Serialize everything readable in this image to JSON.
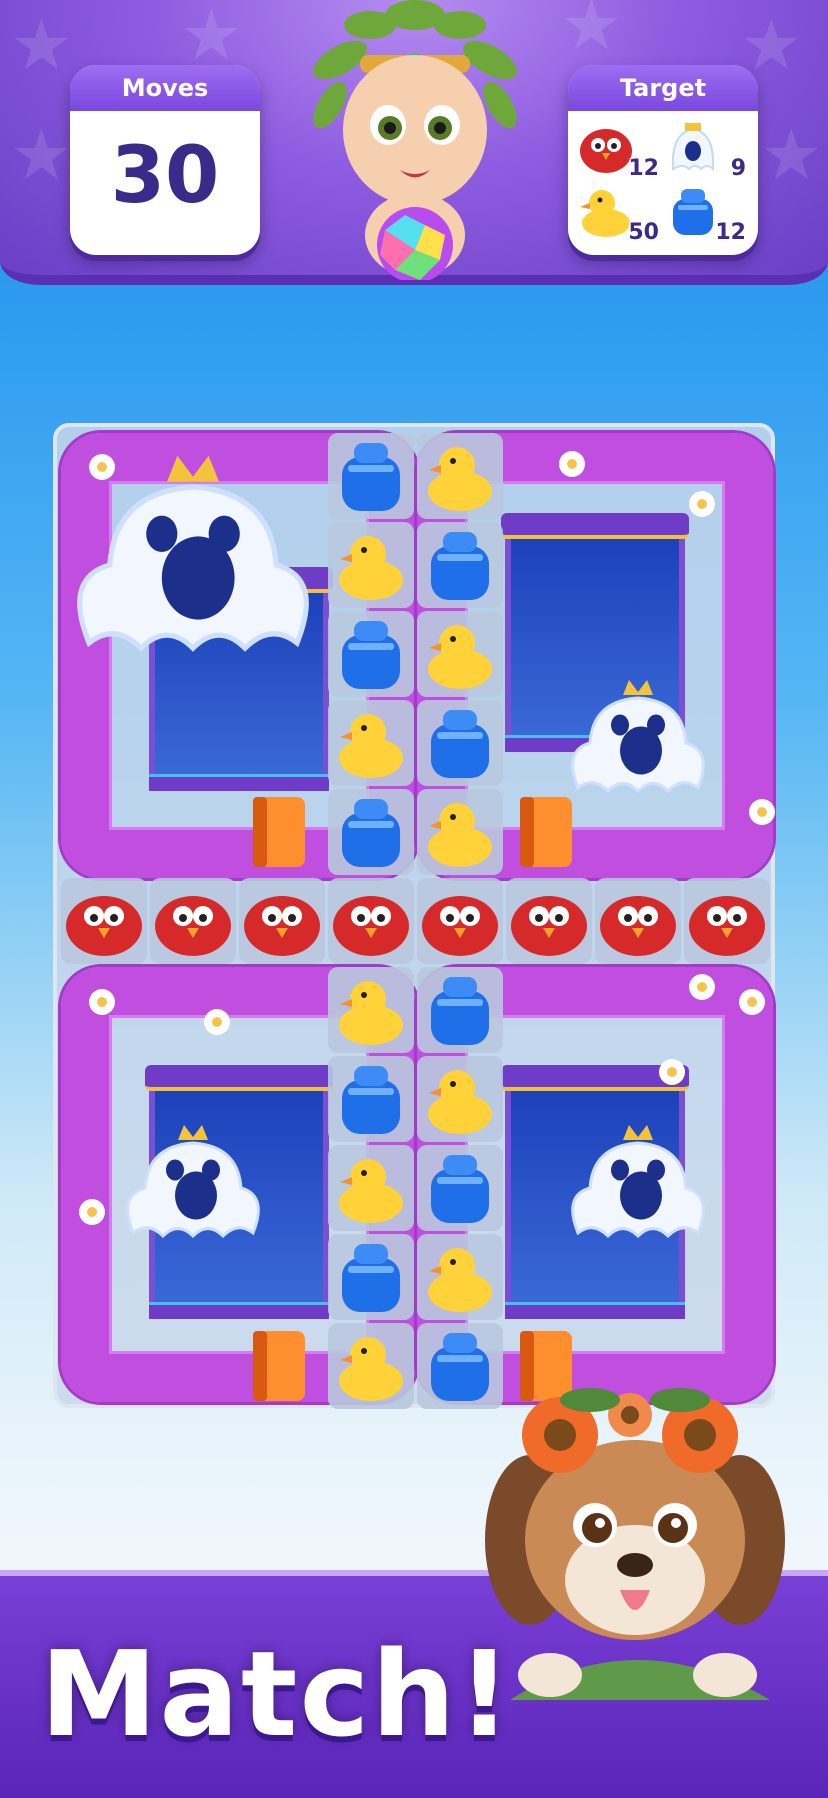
{
  "hud": {
    "moves_label": "Moves",
    "moves_value": "30",
    "target_label": "Target",
    "targets": [
      {
        "icon": "red-bird-icon",
        "count": "12"
      },
      {
        "icon": "ghost-icon",
        "count": "9"
      },
      {
        "icon": "yellow-duck-icon",
        "count": "50"
      },
      {
        "icon": "blue-jar-icon",
        "count": "12"
      }
    ]
  },
  "banner": {
    "text": "Match!"
  },
  "colors": {
    "vine": "#c04fe0",
    "hud": "#8e5ce0",
    "banner": "#6a30c8",
    "duck": "#ffd23a",
    "jar": "#1e6fe8",
    "bird": "#d62a2a"
  },
  "board": {
    "rows": [
      [
        "vine",
        "vine",
        "vine",
        "jar",
        "duck",
        "vine",
        "vine",
        "vine"
      ],
      [
        "vine",
        "ghost-boss",
        "vine",
        "duck",
        "jar",
        "vine",
        "window",
        "vine"
      ],
      [
        "vine",
        "window",
        "vine",
        "jar",
        "duck",
        "vine",
        "window",
        "vine"
      ],
      [
        "vine",
        "window",
        "vine",
        "duck",
        "jar",
        "vine",
        "ghost",
        "vine"
      ],
      [
        "vine",
        "vine",
        "pipe",
        "jar",
        "duck",
        "pipe",
        "vine",
        "vine"
      ],
      [
        "bird",
        "bird",
        "bird",
        "bird",
        "bird",
        "bird",
        "bird",
        "bird"
      ],
      [
        "vine",
        "vine",
        "vine",
        "duck",
        "jar",
        "vine",
        "vine",
        "vine"
      ],
      [
        "vine",
        "window",
        "vine",
        "jar",
        "duck",
        "vine",
        "window",
        "vine"
      ],
      [
        "vine",
        "ghost",
        "vine",
        "duck",
        "jar",
        "vine",
        "ghost",
        "vine"
      ],
      [
        "vine",
        "window",
        "vine",
        "jar",
        "duck",
        "vine",
        "window",
        "vine"
      ],
      [
        "vine",
        "vine",
        "pipe",
        "duck",
        "jar",
        "pipe",
        "vine",
        "vine"
      ]
    ]
  }
}
